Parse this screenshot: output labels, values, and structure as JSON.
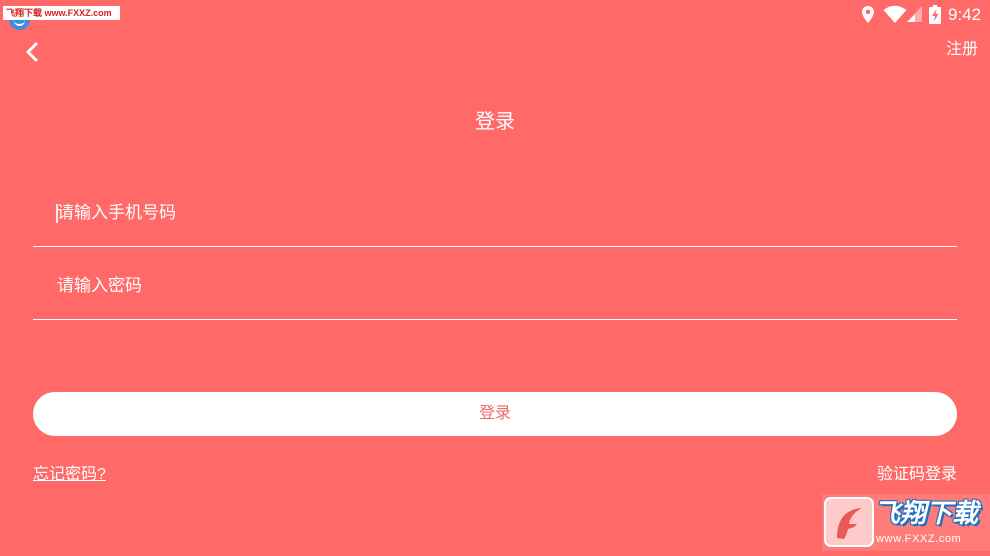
{
  "app": {
    "background_color": "#FF6A68",
    "accent_color": "#EE6966",
    "text_color": "#FFFFFF"
  },
  "watermark_top": {
    "text": "飞翔下载 www.FXXZ.com",
    "notification_icon": "app-notification-icon"
  },
  "status_bar": {
    "time": "9:42",
    "icons": [
      "location-icon",
      "wifi-icon",
      "cell-signal-icon",
      "battery-charging-icon"
    ]
  },
  "header": {
    "back_icon": "chevron-left-icon",
    "register_label": "注册",
    "title": "登录"
  },
  "form": {
    "phone": {
      "value": "",
      "placeholder": "请输入手机号码"
    },
    "password": {
      "value": "",
      "placeholder": "请输入密码"
    },
    "submit_label": "登录"
  },
  "links": {
    "forgot_password": "忘记密码?",
    "sms_code_login": "验证码登录"
  },
  "watermark_bottom": {
    "logo_icon": "fxxz-logo-icon",
    "brand": "飞翔下载",
    "url": "www.FXXZ.com"
  }
}
